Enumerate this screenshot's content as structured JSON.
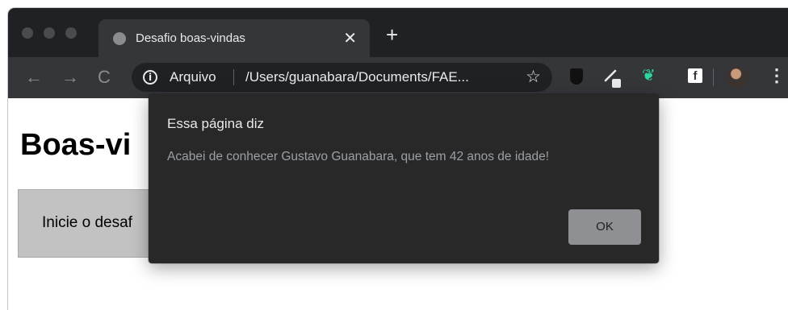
{
  "tab": {
    "title": "Desafio boas-vindas",
    "close_glyph": "✕",
    "new_tab_glyph": "+"
  },
  "toolbar": {
    "back_glyph": "←",
    "forward_glyph": "→",
    "reload_glyph": "C",
    "scheme_label": "Arquivo",
    "url": "/Users/guanabara/Documents/FAE...",
    "star_glyph": "☆",
    "facebook_glyph": "f",
    "menu_glyph": "⋮",
    "info_glyph": "i",
    "green_ext_glyph": "❦"
  },
  "page": {
    "heading": "Boas-vi",
    "start_text": "Inicie o desaf"
  },
  "dialog": {
    "title": "Essa página diz",
    "message": "Acabei de conhecer Gustavo Guanabara, que tem 42 anos de idade!",
    "ok_label": "OK"
  },
  "colors": {
    "chrome_dark": "#202124",
    "toolbar": "#35363a",
    "dialog_bg": "#282828",
    "ok_button": "#8e9094",
    "extension_green": "#2bd9a0"
  }
}
